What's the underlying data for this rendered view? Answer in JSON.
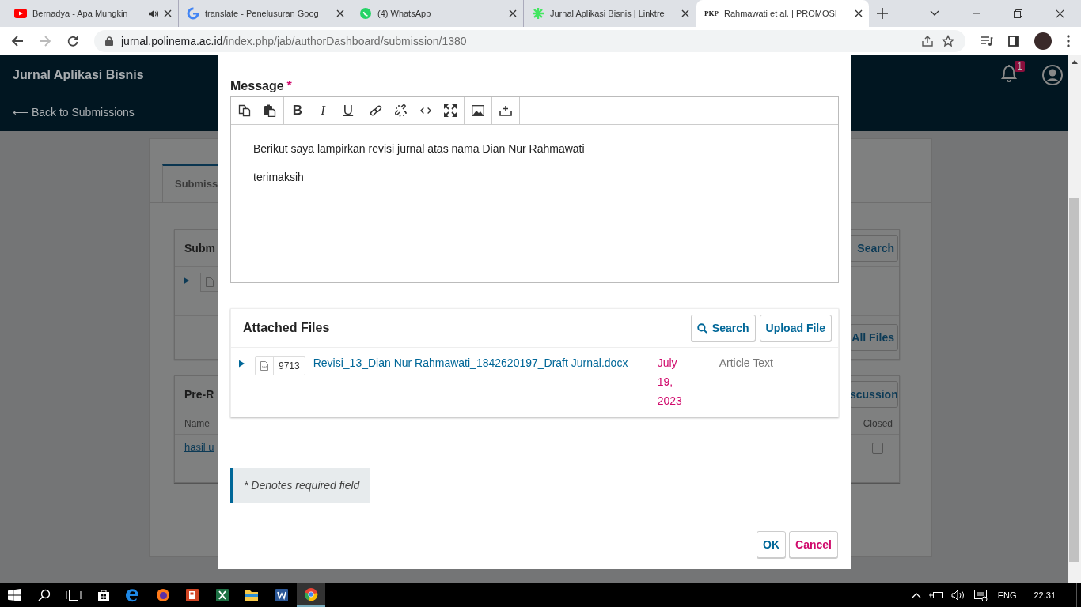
{
  "browser": {
    "tabs": [
      {
        "title": "Bernadya - Apa Mungkin",
        "kind": "video",
        "audio": true,
        "selected": false
      },
      {
        "title": "translate - Penelusuran Goog",
        "kind": "search-g",
        "audio": false,
        "selected": false
      },
      {
        "title": "(4) WhatsApp",
        "kind": "chat",
        "audio": false,
        "selected": false
      },
      {
        "title": "Jurnal Aplikasi Bisnis | Linktre",
        "kind": "sparkle",
        "audio": false,
        "selected": false
      },
      {
        "title": "Rahmawati et al. | PROMOSI",
        "kind": "text",
        "favicon_text": "PKP",
        "audio": false,
        "selected": true
      }
    ],
    "url": {
      "host": "jurnal.polinema.ac.id",
      "path": "/index.php/jab/authorDashboard/submission/1380"
    }
  },
  "header": {
    "title": "Jurnal Aplikasi Bisnis",
    "back_link": "⟵ Back to Submissions",
    "notification_count": "1"
  },
  "background": {
    "tab": "Submiss",
    "files_card": {
      "title": "Subm",
      "search_button": "Search",
      "footer_button": "All Files"
    },
    "discussion_card": {
      "title": "Pre-R",
      "add_button": "scussion",
      "columns": [
        "Name",
        "Closed"
      ],
      "rows": [
        {
          "name": "hasil u",
          "closed": false
        }
      ]
    }
  },
  "modal": {
    "message_label": "Message",
    "required_mark": "*",
    "toolbar": [
      [
        {
          "kind": "copy"
        },
        {
          "kind": "paste"
        }
      ],
      [
        {
          "kind": "bold",
          "glyph": "B"
        },
        {
          "kind": "italic",
          "glyph": "I"
        },
        {
          "kind": "underline",
          "glyph": "U"
        }
      ],
      [
        {
          "kind": "link"
        },
        {
          "kind": "unlink"
        },
        {
          "kind": "code"
        },
        {
          "kind": "fullscreen"
        }
      ],
      [
        {
          "kind": "image"
        }
      ],
      [
        {
          "kind": "upload"
        }
      ]
    ],
    "body": [
      "Berikut saya lampirkan revisi jurnal atas nama Dian Nur Rahmawati",
      "terimaksih"
    ],
    "attached": {
      "title": "Attached Files",
      "search_button": "Search",
      "upload_button": "Upload File",
      "files": [
        {
          "id": "9713",
          "name": "Revisi_13_Dian Nur Rahmawati_1842620197_Draft Jurnal.docx",
          "date": "July 19, 2023",
          "type": "Article Text",
          "expanded": false
        }
      ]
    },
    "note": "* Denotes required field",
    "ok": "OK",
    "cancel": "Cancel"
  },
  "taskbar": {
    "language": "ENG",
    "time": "22.31"
  }
}
